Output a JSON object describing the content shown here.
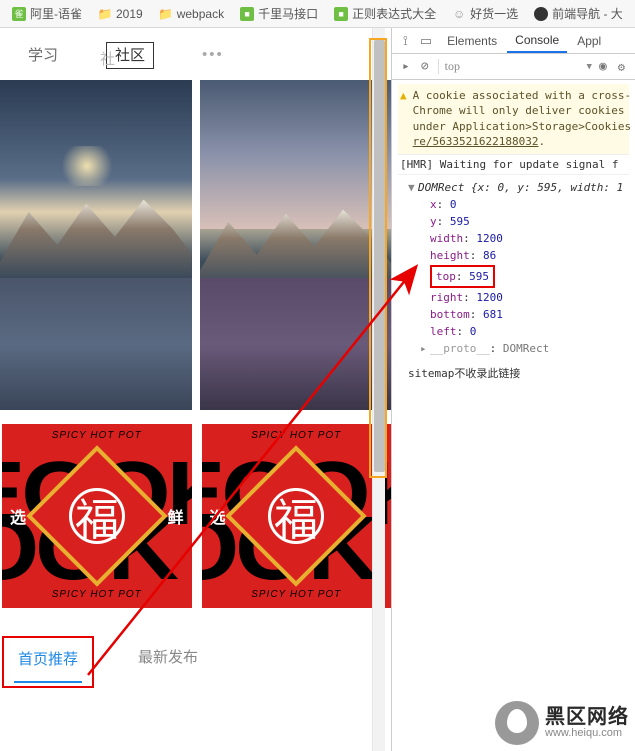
{
  "bookmarks": {
    "item0": "阿里-语雀",
    "item1": "2019",
    "item2": "webpack",
    "item3": "千里马接口",
    "item4": "正则表达式大全",
    "item5": "好货一选",
    "item6": "前端导航 - 大"
  },
  "viewport": {
    "nav": {
      "study": "学习",
      "community_short": "社",
      "community": "社区",
      "more": "•••"
    },
    "card": {
      "toptext": "SPICY HOT POT",
      "bottext": "SPICY HOT POT",
      "side_l": "选",
      "side_r": "鲜",
      "center": "福"
    },
    "tabs": {
      "active": "首页推荐",
      "second": "最新发布"
    }
  },
  "devtools": {
    "tabs": {
      "elements": "Elements",
      "console": "Console",
      "app": "Appl"
    },
    "toolbar": {
      "filter": "top"
    },
    "warn": "A cookie associated with a cross-\nChrome will only deliver cookies \nunder Application>Storage>Cookies",
    "warn_link": "re/5633521622188032",
    "log_hmr": "[HMR] Waiting for update signal f",
    "domrect": {
      "head": "DOMRect {x: 0, y: 595, width: 1",
      "x": {
        "k": "x",
        "v": "0"
      },
      "y": {
        "k": "y",
        "v": "595"
      },
      "width": {
        "k": "width",
        "v": "1200"
      },
      "height": {
        "k": "height",
        "v": "86"
      },
      "top": {
        "k": "top",
        "v": "595"
      },
      "right": {
        "k": "right",
        "v": "1200"
      },
      "bottom": {
        "k": "bottom",
        "v": "681"
      },
      "left": {
        "k": "left",
        "v": "0"
      },
      "proto_k": "__proto__",
      "proto_v": "DOMRect"
    },
    "sitemap": "sitemap不收录此链接"
  },
  "watermark": {
    "cn": "黑区网络",
    "en": "www.heiqu.com"
  }
}
